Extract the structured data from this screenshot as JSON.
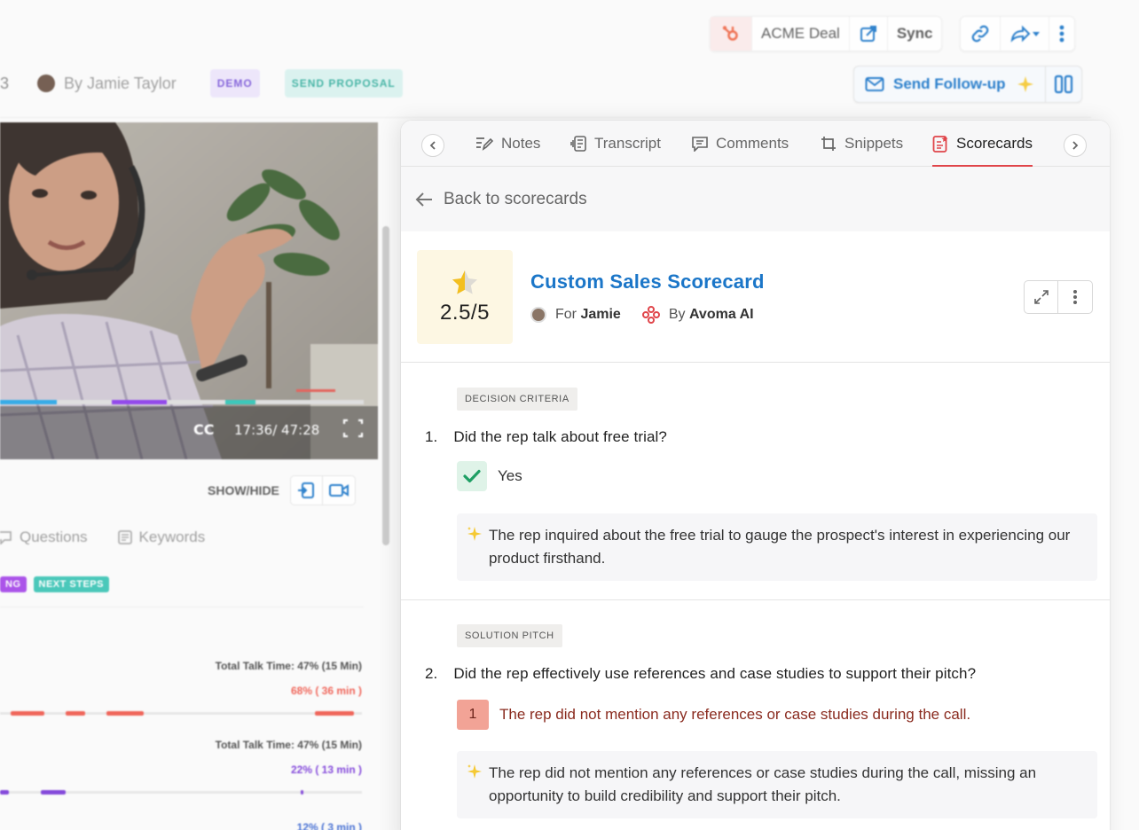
{
  "header": {
    "crm_label": "ACME Deal",
    "sync_label": "Sync",
    "follow_up_label": "Send Follow-up"
  },
  "meeting": {
    "number_fragment": "3",
    "by_label": "By Jamie Taylor",
    "stage_tags": [
      "DEMO",
      "SEND PROPOSAL"
    ]
  },
  "player": {
    "cc_label": "CC",
    "time_label": "17:36/ 47:28",
    "show_hide_label": "SHOW/HIDE"
  },
  "left_tabs": [
    "Questions",
    "Keywords"
  ],
  "left_tags": [
    "NG",
    "NEXT STEPS"
  ],
  "talk_stats": [
    {
      "title": "Total Talk Time: 47% (15 Min)",
      "detail": "68% ( 36 min )",
      "color": "#ef5a4e"
    },
    {
      "title": "Total Talk Time: 47% (15 Min)",
      "detail": "22% ( 13 min )",
      "color": "#7a3bd8"
    },
    {
      "title": "",
      "detail": "12% ( 3 min )",
      "color": "#3a66d0"
    }
  ],
  "panel": {
    "tabs": [
      {
        "label": "Notes",
        "icon": "notes-icon",
        "active": false
      },
      {
        "label": "Transcript",
        "icon": "transcript-icon",
        "active": false
      },
      {
        "label": "Comments",
        "icon": "comments-icon",
        "active": false
      },
      {
        "label": "Snippets",
        "icon": "snippets-icon",
        "active": false
      },
      {
        "label": "Scorecards",
        "icon": "scorecards-icon",
        "active": true
      }
    ],
    "back_label": "Back to scorecards",
    "scorecard": {
      "score": "2.5/5",
      "score_fraction": 0.5,
      "title": "Custom Sales Scorecard",
      "for_prefix": "For",
      "for_name": "Jamie",
      "by_prefix": "By",
      "by_name": "Avoma AI"
    },
    "questions": [
      {
        "category": "DECISION CRITERIA",
        "number": "1.",
        "text": "Did the rep talk about free trial?",
        "answer": "Yes",
        "answer_type": "check",
        "ai_summary": "The rep inquired about the free trial to gauge the prospect's interest in experiencing our product firsthand."
      },
      {
        "category": "SOLUTION PITCH",
        "number": "2.",
        "text": "Did the rep effectively use references and case studies to support their pitch?",
        "answer": "The rep did not mention any references or case studies during the call.",
        "answer_score": "1",
        "answer_type": "rating",
        "ai_summary": "The rep did not mention any references or case studies during the call, missing an opportunity to build credibility and support their pitch."
      }
    ]
  },
  "colors": {
    "accent_blue": "#1b76c8",
    "active_tab_underline": "#e0454a",
    "score_bg": "#fdf7e3",
    "yes_bg": "#dff3e8",
    "low_score_bg": "#f2a396"
  }
}
